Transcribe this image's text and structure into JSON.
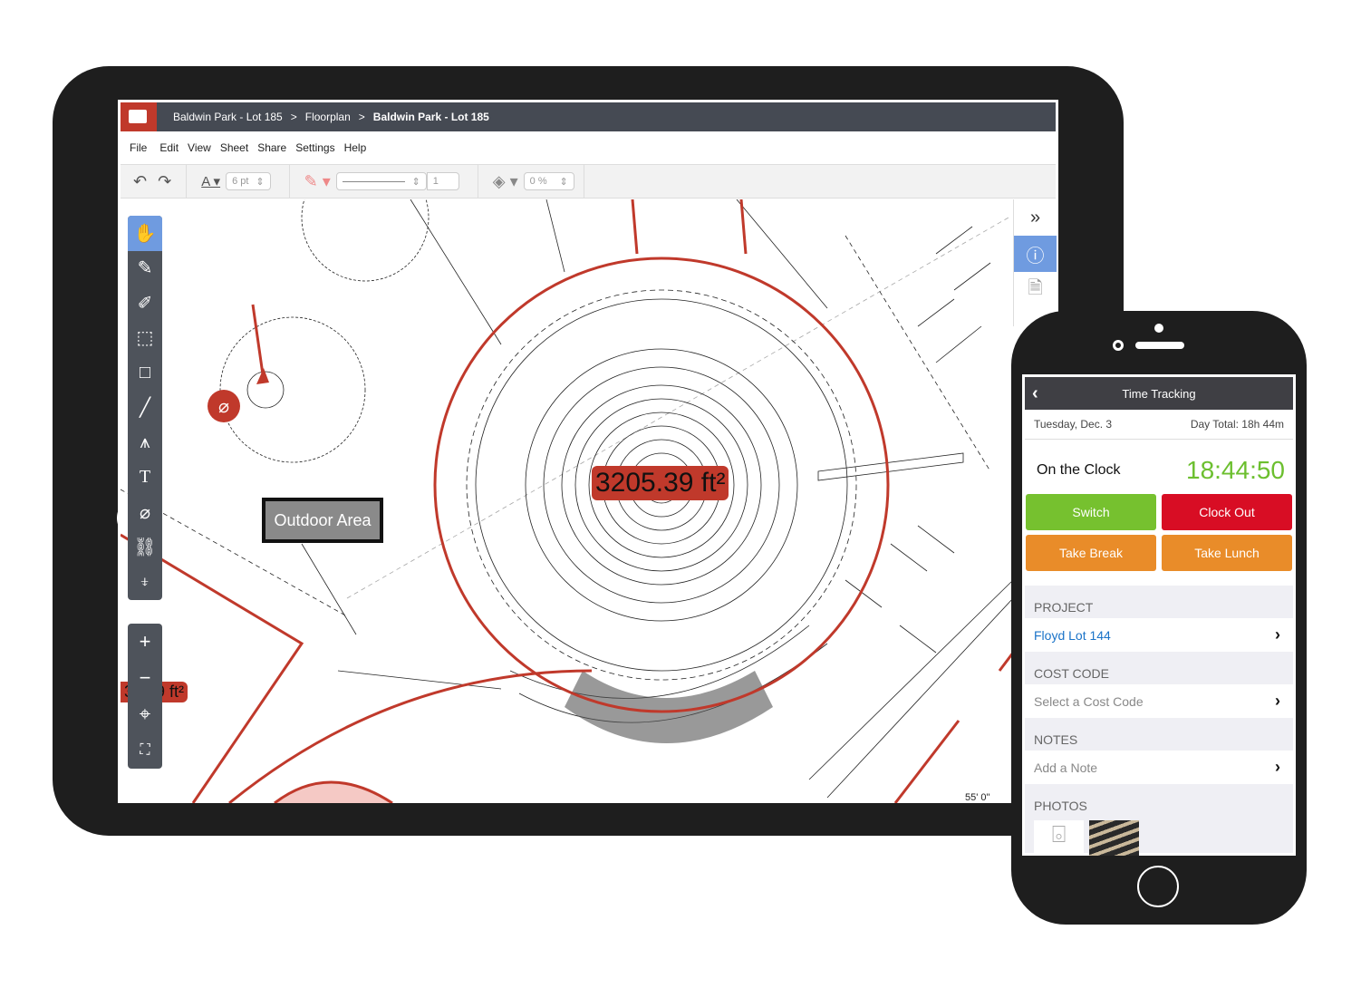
{
  "tablet": {
    "breadcrumb": [
      "Baldwin Park - Lot 185",
      "Floorplan",
      "Baldwin Park - Lot 185"
    ],
    "breadcrumb_separator": ">",
    "menu": [
      "File",
      "Edit",
      "View",
      "Sheet",
      "Share",
      "Settings",
      "Help"
    ],
    "toolbar": {
      "font_size": "6 pt",
      "line_width": "1",
      "opacity": "0 %"
    },
    "tools": [
      "hand-icon",
      "pencil-icon",
      "highlighter-icon",
      "cloud-icon",
      "rectangle-icon",
      "line-icon",
      "compass-icon",
      "text-icon",
      "attachment-icon",
      "link-icon",
      "pin-icon"
    ],
    "zoom_tools": [
      "zoom-in-icon",
      "zoom-out-icon",
      "recenter-icon",
      "fit-icon"
    ],
    "right_panel": [
      "expand-icon",
      "info-icon",
      "document-icon"
    ],
    "canvas": {
      "area_main": "3205.39 ft²",
      "area_left": "35.69 ft²",
      "callout": "Outdoor Area",
      "dimension": "55' 0\""
    },
    "colors": {
      "accent": "#c0392b",
      "active": "#6f9be0",
      "bar": "#454a53"
    }
  },
  "phone": {
    "title": "Time Tracking",
    "date": "Tuesday, Dec. 3",
    "day_total": "Day Total: 18h 44m",
    "status": "On the Clock",
    "timer": "18:44:50",
    "buttons": [
      {
        "label": "Switch",
        "color": "#76c12f"
      },
      {
        "label": "Clock Out",
        "color": "#d80d24"
      },
      {
        "label": "Take Break",
        "color": "#e98c29"
      },
      {
        "label": "Take Lunch",
        "color": "#e98c29"
      }
    ],
    "sections": [
      {
        "header": "PROJECT",
        "value": "Floyd Lot 144"
      },
      {
        "header": "COST CODE",
        "value": "Select a Cost Code"
      },
      {
        "header": "NOTES",
        "value": "Add a Note"
      }
    ],
    "photos_header": "PHOTOS"
  }
}
